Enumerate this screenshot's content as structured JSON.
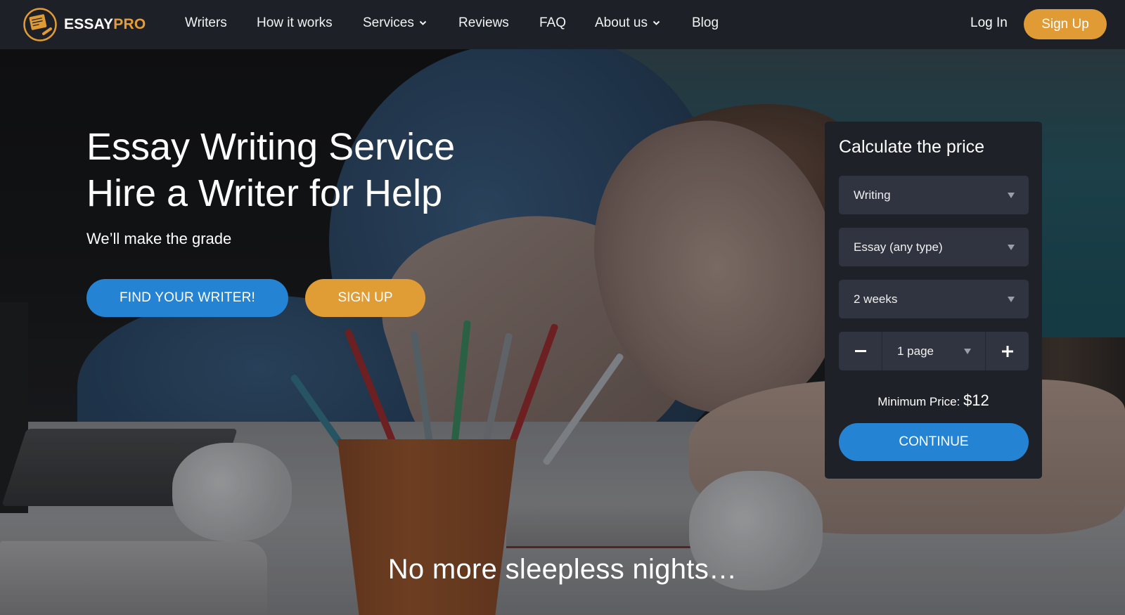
{
  "brand": {
    "name_part1": "ESSAY",
    "name_part2": "PRO",
    "logo_icon": "paper-pencil-icon",
    "accent_color": "#e19b35",
    "primary_color": "#2583d3"
  },
  "nav": {
    "items": [
      {
        "label": "Writers",
        "has_dropdown": false
      },
      {
        "label": "How it works",
        "has_dropdown": false
      },
      {
        "label": "Services",
        "has_dropdown": true
      },
      {
        "label": "Reviews",
        "has_dropdown": false
      },
      {
        "label": "FAQ",
        "has_dropdown": false
      },
      {
        "label": "About us",
        "has_dropdown": true
      },
      {
        "label": "Blog",
        "has_dropdown": false
      }
    ],
    "login_label": "Log In",
    "signup_label": "Sign Up"
  },
  "hero": {
    "title_line1": "Essay Writing Service",
    "title_line2": "Hire a Writer for Help",
    "tagline": "We’ll make the grade",
    "find_writer_label": "FIND YOUR WRITER!",
    "signup_label": "SIGN UP",
    "bottom_text": "No more sleepless nights…"
  },
  "calculator": {
    "title": "Calculate the price",
    "service_type": "Writing",
    "paper_type": "Essay (any type)",
    "deadline": "2 weeks",
    "pages": "1 page",
    "minus_icon": "minus-icon",
    "plus_icon": "plus-icon",
    "min_price_label": "Minimum Price:",
    "min_price_value": "$12",
    "continue_label": "CONTINUE"
  }
}
